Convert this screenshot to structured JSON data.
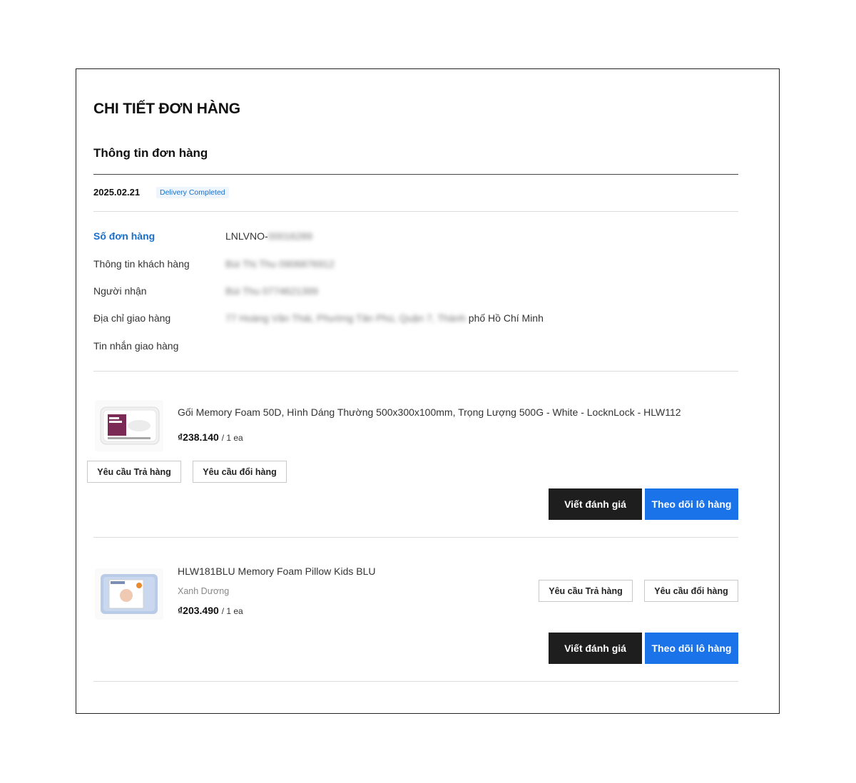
{
  "page_title": "CHI TIẾT ĐƠN HÀNG",
  "section_title": "Thông tin đơn hàng",
  "order": {
    "date": "2025.02.21",
    "status": "Delivery Completed",
    "fields": [
      {
        "label": "Số đơn hàng",
        "value_visible": "LNLVNO-",
        "value_blurred": "00016289"
      },
      {
        "label": "Thông tin khách hàng",
        "value_visible": "",
        "value_blurred": "Bùi Thị Thu 0906876912"
      },
      {
        "label": "Người nhận",
        "value_visible": "",
        "value_blurred": "Bùi Thu 0774621399"
      },
      {
        "label": "Địa chỉ giao hàng",
        "value_blurred": "77 Hoàng Văn Thái, Phường Tân Phú, Quận 7, Thành",
        "value_visible": "phố Hồ Chí Minh"
      },
      {
        "label": "Tin nhắn giao hàng",
        "value_visible": "",
        "value_blurred": ""
      }
    ]
  },
  "items": [
    {
      "name": "Gối Memory Foam 50D, Hình Dáng Thường 500x300x100mm, Trọng Lượng 500G - White - LocknLock - HLW112",
      "variant": "",
      "price": "₫238.140",
      "qty": "/ 1 ea",
      "return_label": "Yêu cầu Trả hàng",
      "exchange_label": "Yêu cầu đổi hàng",
      "review_label": "Viết đánh giá",
      "track_label": "Theo dõi lô hàng",
      "thumb_icon": "white-pillow-product-image"
    },
    {
      "name": "HLW181BLU Memory Foam Pillow Kids BLU",
      "variant": "Xanh Dương",
      "price": "₫203.490",
      "qty": "/ 1 ea",
      "return_label": "Yêu cầu Trả hàng",
      "exchange_label": "Yêu cầu đổi hàng",
      "review_label": "Viết đánh giá",
      "track_label": "Theo dõi lô hàng",
      "thumb_icon": "blue-kids-pillow-product-image"
    }
  ],
  "colors": {
    "accent_blue": "#1a73e8",
    "link_blue": "#1a6fc9",
    "dark_button": "#1e1e1e"
  }
}
